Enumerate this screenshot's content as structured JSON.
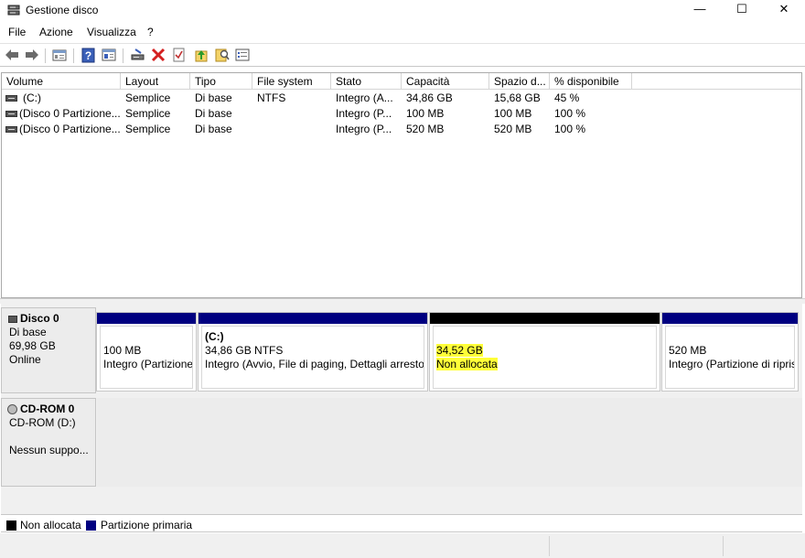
{
  "window": {
    "title": "Gestione disco",
    "minimize_symbol": "—",
    "maximize_symbol": "☐",
    "close_symbol": "✕"
  },
  "menu": [
    "File",
    "Azione",
    "Visualizza",
    "?"
  ],
  "toolbar_icons": [
    "back-icon",
    "forward-icon",
    "properties-icon",
    "help-icon",
    "show-hide-icon",
    "connect-icon",
    "delete-icon",
    "check-icon",
    "up-icon",
    "search-icon",
    "list-icon"
  ],
  "list": {
    "columns": [
      "Volume",
      "Layout",
      "Tipo",
      "File system",
      "Stato",
      "Capacità",
      "Spazio d...",
      "% disponibile"
    ],
    "rows": [
      [
        "(C:)",
        "Semplice",
        "Di base",
        "NTFS",
        "Integro (A...",
        "34,86 GB",
        "15,68 GB",
        "45 %"
      ],
      [
        "(Disco 0 Partizione...",
        "Semplice",
        "Di base",
        "",
        "Integro (P...",
        "100 MB",
        "100 MB",
        "100 %"
      ],
      [
        "(Disco 0 Partizione...",
        "Semplice",
        "Di base",
        "",
        "Integro (P...",
        "520 MB",
        "520 MB",
        "100 %"
      ]
    ]
  },
  "disk0": {
    "name": "Disco 0",
    "type": "Di base",
    "size": "69,98 GB",
    "status": "Online",
    "partitions": [
      {
        "title": "",
        "size": "100 MB",
        "status": "Integro (Partizione"
      },
      {
        "title": "(C:)",
        "size": "34,86 GB NTFS",
        "status": "Integro (Avvio, File di paging, Dettagli arresto"
      },
      {
        "title": "",
        "size": "34,52 GB",
        "status": "Non allocata"
      },
      {
        "title": "",
        "size": "520 MB",
        "status": "Integro (Partizione di ripris"
      }
    ]
  },
  "cdrom0": {
    "name": "CD-ROM 0",
    "type": "CD-ROM (D:)",
    "status": "Nessun suppo..."
  },
  "legend": {
    "unallocated": "Non allocata",
    "primary": "Partizione primaria"
  },
  "colors": {
    "primary_partition": "#000080",
    "unallocated": "#000000",
    "highlight": "#ffff38"
  }
}
